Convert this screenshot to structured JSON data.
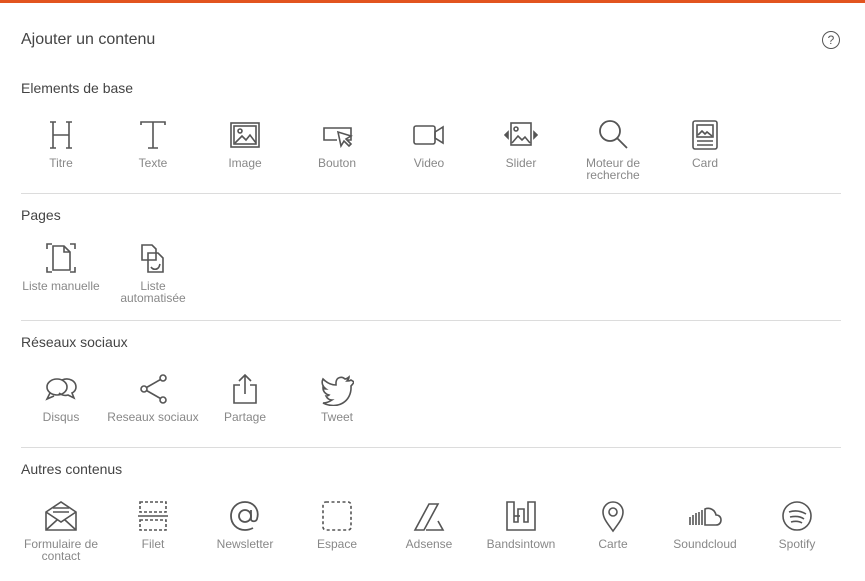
{
  "header": {
    "title": "Ajouter un contenu",
    "help_icon": "?"
  },
  "colors": {
    "accent": "#e2541f",
    "icon": "#555555",
    "label": "#888888",
    "divider": "#dcdcdc"
  },
  "sections": [
    {
      "title": "Elements de base",
      "items": [
        {
          "label": "Titre",
          "icon": "heading-icon"
        },
        {
          "label": "Texte",
          "icon": "text-icon"
        },
        {
          "label": "Image",
          "icon": "image-icon"
        },
        {
          "label": "Bouton",
          "icon": "button-icon"
        },
        {
          "label": "Video",
          "icon": "video-icon"
        },
        {
          "label": "Slider",
          "icon": "slider-icon"
        },
        {
          "label": "Moteur de recherche",
          "icon": "search-icon"
        },
        {
          "label": "Card",
          "icon": "card-icon"
        }
      ]
    },
    {
      "title": "Pages",
      "items": [
        {
          "label": "Liste manuelle",
          "icon": "manual-list-icon"
        },
        {
          "label": "Liste automatisée",
          "icon": "auto-list-icon"
        }
      ]
    },
    {
      "title": "Réseaux sociaux",
      "items": [
        {
          "label": "Disqus",
          "icon": "chat-bubbles-icon"
        },
        {
          "label": "Reseaux sociaux",
          "icon": "share-icon"
        },
        {
          "label": "Partage",
          "icon": "upload-share-icon"
        },
        {
          "label": "Tweet",
          "icon": "twitter-bird-icon"
        }
      ]
    },
    {
      "title": "Autres contenus",
      "items": [
        {
          "label": "Formulaire de contact",
          "icon": "mail-form-icon"
        },
        {
          "label": "Filet",
          "icon": "separator-icon"
        },
        {
          "label": "Newsletter",
          "icon": "at-sign-icon"
        },
        {
          "label": "Espace",
          "icon": "spacer-icon"
        },
        {
          "label": "Adsense",
          "icon": "adsense-icon"
        },
        {
          "label": "Bandsintown",
          "icon": "bandsintown-icon"
        },
        {
          "label": "Carte",
          "icon": "map-pin-icon"
        },
        {
          "label": "Soundcloud",
          "icon": "soundcloud-icon"
        },
        {
          "label": "Spotify",
          "icon": "spotify-icon"
        }
      ]
    }
  ]
}
